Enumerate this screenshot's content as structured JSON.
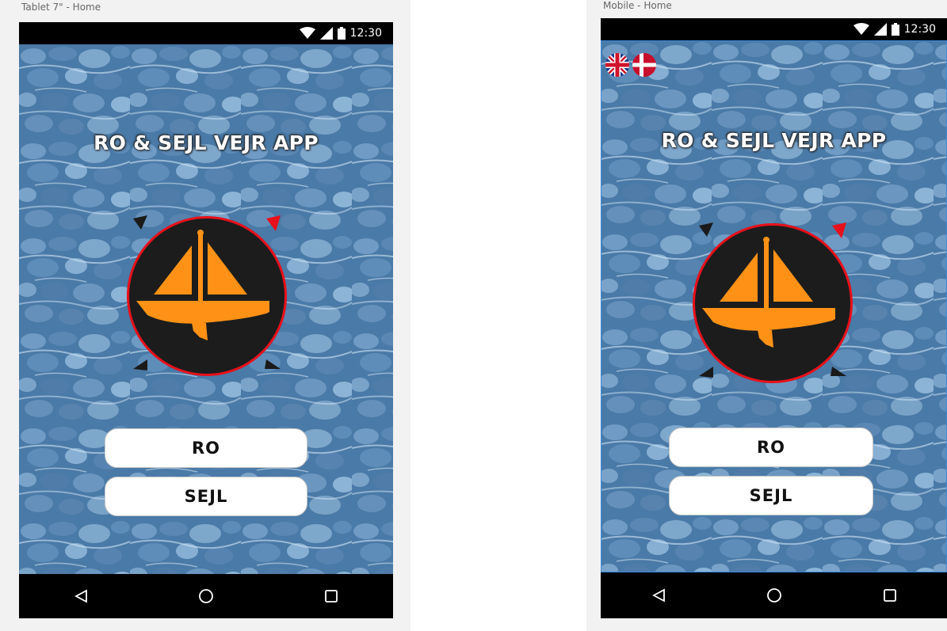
{
  "artboards": {
    "tablet_label": "Tablet 7\" - Home",
    "mobile_label": "Mobile - Home"
  },
  "status_bar": {
    "time": "12:30"
  },
  "app": {
    "title": "RO & SEJL VEJR APP",
    "ro_label": "RO",
    "sejl_label": "SEJL"
  },
  "icons": {
    "wifi": "wifi-icon",
    "signal": "signal-icon",
    "battery": "battery-icon",
    "back": "back-triangle-icon",
    "home": "home-circle-icon",
    "recents": "recents-square-icon",
    "logo": "sailboat-compass-logo",
    "flag_en": "uk-flag-icon",
    "flag_da": "denmark-flag-icon"
  },
  "colors": {
    "accent_orange": "#ff9116",
    "ring_red": "#e8101a",
    "logo_dark": "#1a1a1a",
    "water_blue": "#3d6f9e"
  }
}
